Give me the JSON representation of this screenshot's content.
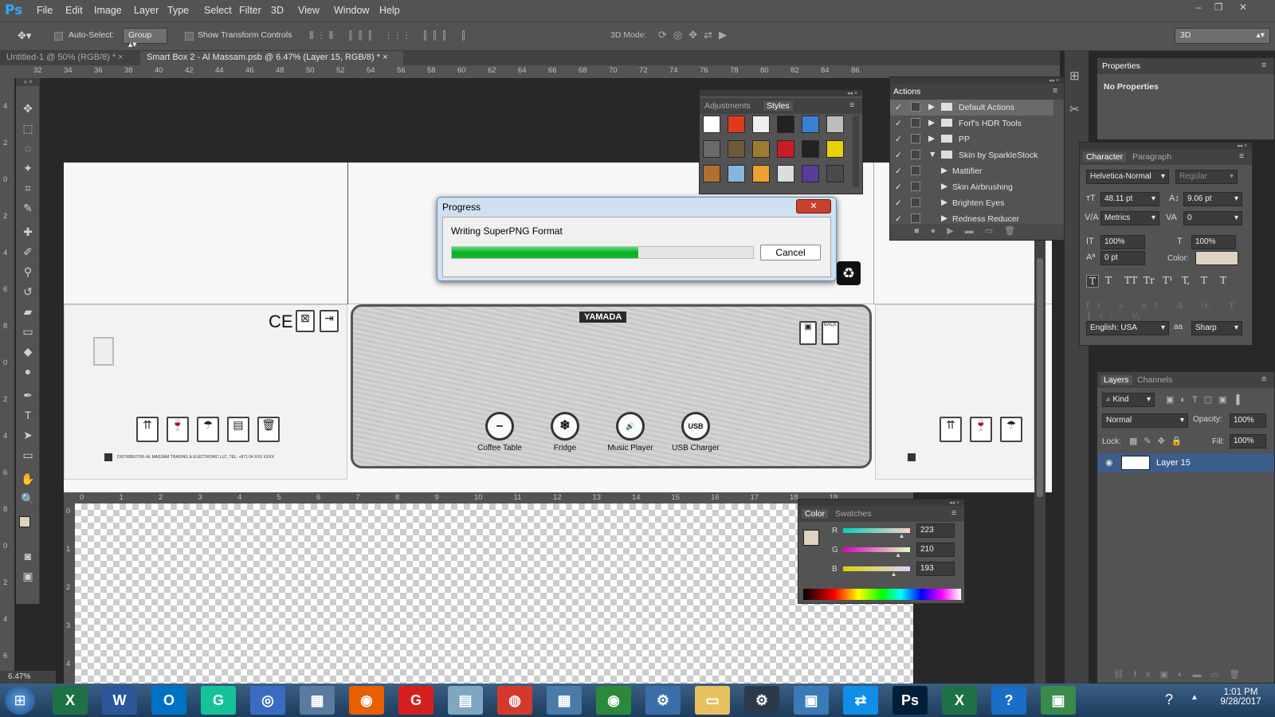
{
  "app": {
    "logo": "Ps"
  },
  "menu": [
    "File",
    "Edit",
    "Image",
    "Layer",
    "Type",
    "Select",
    "Filter",
    "3D",
    "View",
    "Window",
    "Help"
  ],
  "window_controls": {
    "minimize": "–",
    "restore": "❐",
    "close": "✕"
  },
  "options": {
    "auto_select_label": "Auto-Select:",
    "auto_select_value": "Group",
    "transform_label": "Show Transform Controls",
    "mode_label": "3D Mode:",
    "workspace": "3D"
  },
  "doc_tabs": [
    {
      "label": "Untitled-1 @ 50% (RGB/8) *",
      "close": "×"
    },
    {
      "label": "Smart Box 2 - Al Massam.psb @ 6.47% (Layer 15, RGB/8) *",
      "close": "×"
    }
  ],
  "ruler_top": [
    "32",
    "34",
    "36",
    "38",
    "40",
    "42",
    "44",
    "46",
    "48",
    "50",
    "52",
    "54",
    "56",
    "58",
    "60",
    "62",
    "64",
    "66",
    "68",
    "70",
    "72",
    "74",
    "76",
    "78",
    "80",
    "82",
    "84",
    "86"
  ],
  "ruler_left": [
    "4",
    "2",
    "0",
    "2",
    "4",
    "6",
    "8",
    "0",
    "2",
    "4",
    "6",
    "8",
    "0",
    "2",
    "4",
    "6",
    "8"
  ],
  "ruler_inner": [
    "0",
    "1",
    "2",
    "3",
    "4",
    "5",
    "6",
    "7",
    "8",
    "9",
    "10",
    "11",
    "12",
    "13",
    "14",
    "15",
    "16",
    "17",
    "18",
    "19"
  ],
  "ruler_inner_left": [
    "0",
    "1",
    "2",
    "3",
    "4"
  ],
  "zoom": "6.47%",
  "artwork": {
    "ce_mark": "CE",
    "brand": "YAMADA",
    "features": [
      {
        "icon": "–",
        "label": "Coffee Table"
      },
      {
        "icon": "❄",
        "label": "Fridge"
      },
      {
        "icon": "🔊",
        "label": "Music Player"
      },
      {
        "icon": "USB",
        "label": "USB Charger"
      }
    ],
    "back_label": "BACK",
    "distributor_text": "DISTRIBUTOR: AL MASSAM TRADING & ELECTRONIC LLC. TEL: +971 04 XXX XXXX"
  },
  "progress_dialog": {
    "title": "Progress",
    "message": "Writing SuperPNG Format",
    "percent": 0.62,
    "cancel_label": "Cancel",
    "close": "✕"
  },
  "styles_panel": {
    "tabs": [
      "Adjustments",
      "Styles"
    ],
    "active": "Styles",
    "swatches": [
      "#fff",
      "#e03a1a",
      "#eee",
      "#222",
      "#3a7fd0",
      "#bdbdbd",
      "#6a6a6a",
      "#6b5b3a",
      "#a07a30",
      "#c81d25",
      "#222",
      "#e8d200",
      "#b07030",
      "#88b5e0",
      "#f0a030",
      "#ddd",
      "#5a3a9a",
      "#4a4a4a"
    ]
  },
  "actions_panel": {
    "title": "Actions",
    "items": [
      {
        "label": "Default Actions",
        "level": 0,
        "selected": true
      },
      {
        "label": "Forf's HDR Tools",
        "level": 0
      },
      {
        "label": "PP",
        "level": 0
      },
      {
        "label": "Skin by SparkleStock",
        "level": 0,
        "open": true
      },
      {
        "label": "Mattifier",
        "level": 1
      },
      {
        "label": "Skin Airbrushing",
        "level": 1
      },
      {
        "label": "Brighten Eyes",
        "level": 1
      },
      {
        "label": "Redness Reducer",
        "level": 1
      }
    ]
  },
  "properties_panel": {
    "title": "Properties",
    "body": "No Properties"
  },
  "character_panel": {
    "tabs": [
      "Character",
      "Paragraph"
    ],
    "font": "Helvetica-Normal",
    "style": "Regular",
    "size": "48.11 pt",
    "leading": "9.06 pt",
    "kerning": "Metrics",
    "tracking": "0",
    "vscale": "100%",
    "hscale": "100%",
    "baseline": "0 pt",
    "color_label": "Color:",
    "color_value": "#dfd2c1",
    "language": "English: USA",
    "aa_label": "aa",
    "antialias": "Sharp",
    "style_buttons": [
      "T",
      "T",
      "TT",
      "Tr",
      "T¹",
      "T,",
      "T",
      "T"
    ]
  },
  "layers_panel": {
    "tabs": [
      "Layers",
      "Channels"
    ],
    "filter": "Kind",
    "blend": "Normal",
    "opacity_label": "Opacity:",
    "opacity": "100%",
    "lock_label": "Lock:",
    "fill_label": "Fill:",
    "fill": "100%",
    "layer": "Layer 15"
  },
  "color_panel": {
    "tabs": [
      "Color",
      "Swatches"
    ],
    "channels": [
      {
        "name": "R",
        "value": "223"
      },
      {
        "name": "G",
        "value": "210"
      },
      {
        "name": "B",
        "value": "193"
      }
    ]
  },
  "taskbar": {
    "icons": [
      {
        "name": "excel",
        "glyph": "X",
        "bg": "#1e7145"
      },
      {
        "name": "word",
        "glyph": "W",
        "bg": "#2b579a"
      },
      {
        "name": "outlook",
        "glyph": "O",
        "bg": "#0072c6"
      },
      {
        "name": "grammarly",
        "glyph": "G",
        "bg": "#15c39a"
      },
      {
        "name": "app-blue",
        "glyph": "◎",
        "bg": "#3b6cc4"
      },
      {
        "name": "chart-app",
        "glyph": "▦",
        "bg": "#5a7aa0"
      },
      {
        "name": "firefox",
        "glyph": "◉",
        "bg": "#e66000"
      },
      {
        "name": "app-red",
        "glyph": "G",
        "bg": "#d62020"
      },
      {
        "name": "notes",
        "glyph": "▤",
        "bg": "#7fa8c0"
      },
      {
        "name": "chrome",
        "glyph": "◍",
        "bg": "#d33a2c"
      },
      {
        "name": "calculator",
        "glyph": "▦",
        "bg": "#4a7aa8"
      },
      {
        "name": "globe",
        "glyph": "◉",
        "bg": "#2a8a3a"
      },
      {
        "name": "settings",
        "glyph": "⚙",
        "bg": "#3a6ea8"
      },
      {
        "name": "explorer",
        "glyph": "▭",
        "bg": "#e8c060"
      },
      {
        "name": "gear",
        "glyph": "⚙",
        "bg": "#2a3a4a"
      },
      {
        "name": "control-panel",
        "glyph": "▣",
        "bg": "#3a7ab8"
      },
      {
        "name": "teamviewer",
        "glyph": "⇄",
        "bg": "#0e8ee9"
      },
      {
        "name": "photoshop",
        "glyph": "Ps",
        "bg": "#001e36"
      },
      {
        "name": "excel-2",
        "glyph": "X",
        "bg": "#1e7145"
      },
      {
        "name": "help",
        "glyph": "?",
        "bg": "#1a6ec8"
      },
      {
        "name": "remote",
        "glyph": "▣",
        "bg": "#3a8a4a"
      }
    ],
    "time": "1:01 PM",
    "date": "9/28/2017"
  }
}
